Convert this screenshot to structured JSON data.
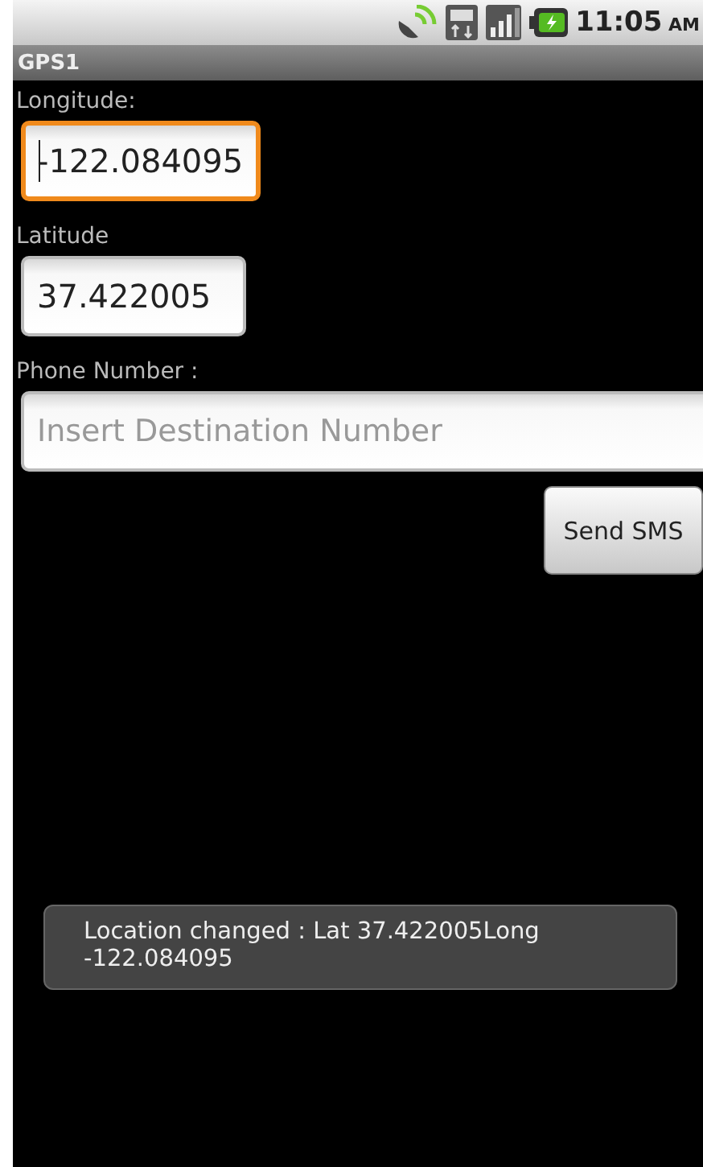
{
  "status_bar": {
    "time": "11:05",
    "ampm": "AM"
  },
  "title_bar": {
    "title": "GPS1"
  },
  "fields": [
    {
      "label": "Longitude:",
      "value": "-122.084095",
      "focused": true,
      "kind": "compact"
    },
    {
      "label": "Latitude",
      "value": "37.422005",
      "focused": false,
      "kind": "compact"
    },
    {
      "label": "Phone Number :",
      "placeholder": "Insert Destination Number",
      "focused": false,
      "kind": "wide"
    }
  ],
  "send_button": {
    "label": "Send SMS"
  },
  "toast": {
    "message": "Location changed : Lat 37.422005Long -122.084095"
  }
}
